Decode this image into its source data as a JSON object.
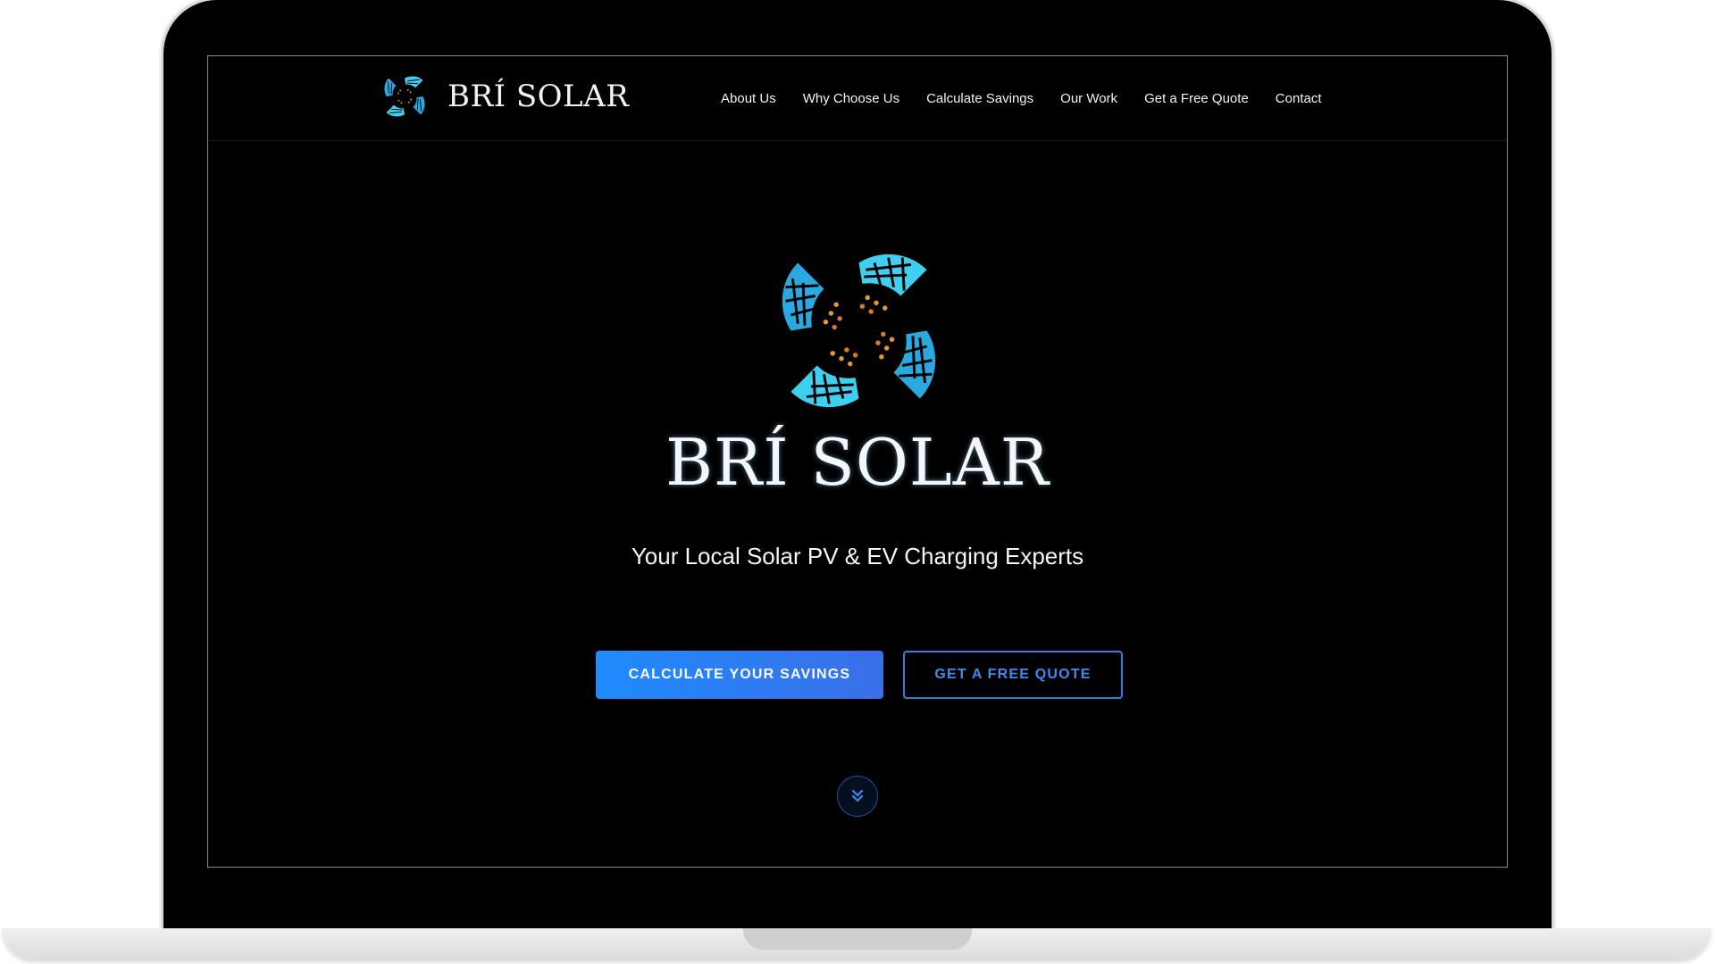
{
  "brand": {
    "name": "BRÍ SOLAR",
    "logo_icon": "solar-pinwheel-icon",
    "accent_cyan": "#3fd0f0",
    "accent_blue": "#1f8bff",
    "accent_orange": "#e8953a"
  },
  "nav": {
    "items": [
      {
        "label": "About Us"
      },
      {
        "label": "Why Choose Us"
      },
      {
        "label": "Calculate Savings"
      },
      {
        "label": "Our Work"
      },
      {
        "label": "Get a Free Quote"
      },
      {
        "label": "Contact"
      }
    ]
  },
  "hero": {
    "title": "BRÍ SOLAR",
    "subtitle": "Your Local Solar PV & EV Charging Experts",
    "primary_button": "CALCULATE YOUR SAVINGS",
    "secondary_button": "GET A FREE QUOTE",
    "scroll_icon": "double-chevron-down-icon"
  }
}
